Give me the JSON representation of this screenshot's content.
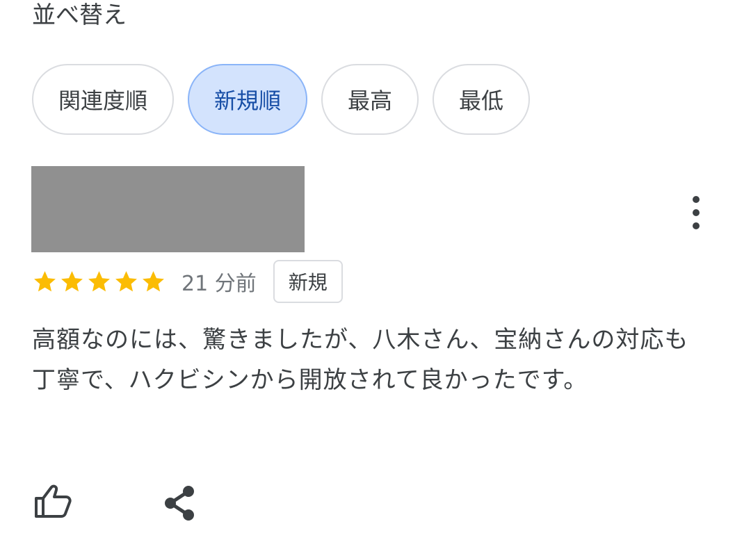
{
  "sort": {
    "title": "並べ替え",
    "options": [
      {
        "label": "関連度順",
        "selected": false
      },
      {
        "label": "新規順",
        "selected": true
      },
      {
        "label": "最高",
        "selected": false
      },
      {
        "label": "最低",
        "selected": false
      }
    ]
  },
  "review": {
    "rating": 5,
    "max_rating": 5,
    "time": "21 分前",
    "badge": "新規",
    "text": "高額なのには、驚きましたが、八木さん、宝納さんの対応も丁寧で、ハクビシンから開放されて良かったです。"
  },
  "icons": {
    "more": "more-vert-icon",
    "star": "star-icon",
    "like": "thumb-up-icon",
    "share": "share-icon"
  },
  "colors": {
    "star": "#fbbc04",
    "chip_selected_bg": "#d3e3fd",
    "chip_selected_text": "#174ea6",
    "redaction": "#909090"
  }
}
